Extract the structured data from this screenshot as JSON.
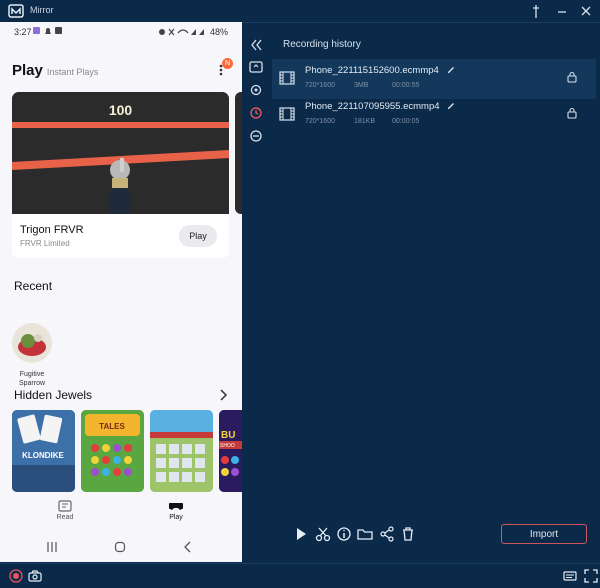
{
  "window": {
    "title": "Mirror"
  },
  "phone": {
    "status": {
      "time": "3:27",
      "battery": "48%"
    },
    "header": {
      "title": "Play",
      "subtitle": "Instant Plays",
      "notification_badge": "N"
    },
    "featured": {
      "score": "100",
      "name": "Trigon FRVR",
      "developer": "FRVR Limited",
      "play_label": "Play"
    },
    "recent": {
      "title": "Recent",
      "items": [
        {
          "label_line1": "Fugitive",
          "label_line2": "Sparrow"
        }
      ]
    },
    "hidden_jewels": {
      "title": "Hidden Jewels",
      "tile_texts": [
        "KLONDIKE",
        "TALES",
        "BU",
        "SHOO"
      ]
    },
    "nav": {
      "read_label": "Read",
      "play_label": "Play"
    }
  },
  "recording_history": {
    "title": "Recording history",
    "items": [
      {
        "name": "Phone_221115152600.ecmmp4",
        "resolution": "720*1600",
        "size": "3MB",
        "duration": "00:00:55"
      },
      {
        "name": "Phone_221107095955.ecmmp4",
        "resolution": "720*1600",
        "size": "181KB",
        "duration": "00:00:05"
      }
    ]
  },
  "actions": {
    "import_label": "Import"
  },
  "colors": {
    "accent": "#d0545e",
    "panel_bg": "#0b2a4a",
    "selected_row": "#13385c",
    "badge": "#ff6a3d"
  }
}
